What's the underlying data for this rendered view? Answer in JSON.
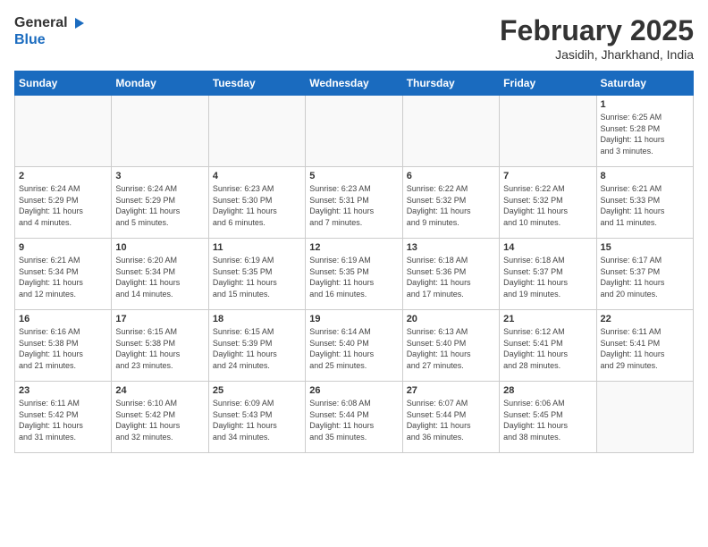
{
  "header": {
    "logo_line1": "General",
    "logo_line2": "Blue",
    "main_title": "February 2025",
    "sub_title": "Jasidih, Jharkhand, India"
  },
  "days_of_week": [
    "Sunday",
    "Monday",
    "Tuesday",
    "Wednesday",
    "Thursday",
    "Friday",
    "Saturday"
  ],
  "weeks": [
    [
      {
        "day": "",
        "info": ""
      },
      {
        "day": "",
        "info": ""
      },
      {
        "day": "",
        "info": ""
      },
      {
        "day": "",
        "info": ""
      },
      {
        "day": "",
        "info": ""
      },
      {
        "day": "",
        "info": ""
      },
      {
        "day": "1",
        "info": "Sunrise: 6:25 AM\nSunset: 5:28 PM\nDaylight: 11 hours\nand 3 minutes."
      }
    ],
    [
      {
        "day": "2",
        "info": "Sunrise: 6:24 AM\nSunset: 5:29 PM\nDaylight: 11 hours\nand 4 minutes."
      },
      {
        "day": "3",
        "info": "Sunrise: 6:24 AM\nSunset: 5:29 PM\nDaylight: 11 hours\nand 5 minutes."
      },
      {
        "day": "4",
        "info": "Sunrise: 6:23 AM\nSunset: 5:30 PM\nDaylight: 11 hours\nand 6 minutes."
      },
      {
        "day": "5",
        "info": "Sunrise: 6:23 AM\nSunset: 5:31 PM\nDaylight: 11 hours\nand 7 minutes."
      },
      {
        "day": "6",
        "info": "Sunrise: 6:22 AM\nSunset: 5:32 PM\nDaylight: 11 hours\nand 9 minutes."
      },
      {
        "day": "7",
        "info": "Sunrise: 6:22 AM\nSunset: 5:32 PM\nDaylight: 11 hours\nand 10 minutes."
      },
      {
        "day": "8",
        "info": "Sunrise: 6:21 AM\nSunset: 5:33 PM\nDaylight: 11 hours\nand 11 minutes."
      }
    ],
    [
      {
        "day": "9",
        "info": "Sunrise: 6:21 AM\nSunset: 5:34 PM\nDaylight: 11 hours\nand 12 minutes."
      },
      {
        "day": "10",
        "info": "Sunrise: 6:20 AM\nSunset: 5:34 PM\nDaylight: 11 hours\nand 14 minutes."
      },
      {
        "day": "11",
        "info": "Sunrise: 6:19 AM\nSunset: 5:35 PM\nDaylight: 11 hours\nand 15 minutes."
      },
      {
        "day": "12",
        "info": "Sunrise: 6:19 AM\nSunset: 5:35 PM\nDaylight: 11 hours\nand 16 minutes."
      },
      {
        "day": "13",
        "info": "Sunrise: 6:18 AM\nSunset: 5:36 PM\nDaylight: 11 hours\nand 17 minutes."
      },
      {
        "day": "14",
        "info": "Sunrise: 6:18 AM\nSunset: 5:37 PM\nDaylight: 11 hours\nand 19 minutes."
      },
      {
        "day": "15",
        "info": "Sunrise: 6:17 AM\nSunset: 5:37 PM\nDaylight: 11 hours\nand 20 minutes."
      }
    ],
    [
      {
        "day": "16",
        "info": "Sunrise: 6:16 AM\nSunset: 5:38 PM\nDaylight: 11 hours\nand 21 minutes."
      },
      {
        "day": "17",
        "info": "Sunrise: 6:15 AM\nSunset: 5:38 PM\nDaylight: 11 hours\nand 23 minutes."
      },
      {
        "day": "18",
        "info": "Sunrise: 6:15 AM\nSunset: 5:39 PM\nDaylight: 11 hours\nand 24 minutes."
      },
      {
        "day": "19",
        "info": "Sunrise: 6:14 AM\nSunset: 5:40 PM\nDaylight: 11 hours\nand 25 minutes."
      },
      {
        "day": "20",
        "info": "Sunrise: 6:13 AM\nSunset: 5:40 PM\nDaylight: 11 hours\nand 27 minutes."
      },
      {
        "day": "21",
        "info": "Sunrise: 6:12 AM\nSunset: 5:41 PM\nDaylight: 11 hours\nand 28 minutes."
      },
      {
        "day": "22",
        "info": "Sunrise: 6:11 AM\nSunset: 5:41 PM\nDaylight: 11 hours\nand 29 minutes."
      }
    ],
    [
      {
        "day": "23",
        "info": "Sunrise: 6:11 AM\nSunset: 5:42 PM\nDaylight: 11 hours\nand 31 minutes."
      },
      {
        "day": "24",
        "info": "Sunrise: 6:10 AM\nSunset: 5:42 PM\nDaylight: 11 hours\nand 32 minutes."
      },
      {
        "day": "25",
        "info": "Sunrise: 6:09 AM\nSunset: 5:43 PM\nDaylight: 11 hours\nand 34 minutes."
      },
      {
        "day": "26",
        "info": "Sunrise: 6:08 AM\nSunset: 5:44 PM\nDaylight: 11 hours\nand 35 minutes."
      },
      {
        "day": "27",
        "info": "Sunrise: 6:07 AM\nSunset: 5:44 PM\nDaylight: 11 hours\nand 36 minutes."
      },
      {
        "day": "28",
        "info": "Sunrise: 6:06 AM\nSunset: 5:45 PM\nDaylight: 11 hours\nand 38 minutes."
      },
      {
        "day": "",
        "info": ""
      }
    ]
  ]
}
